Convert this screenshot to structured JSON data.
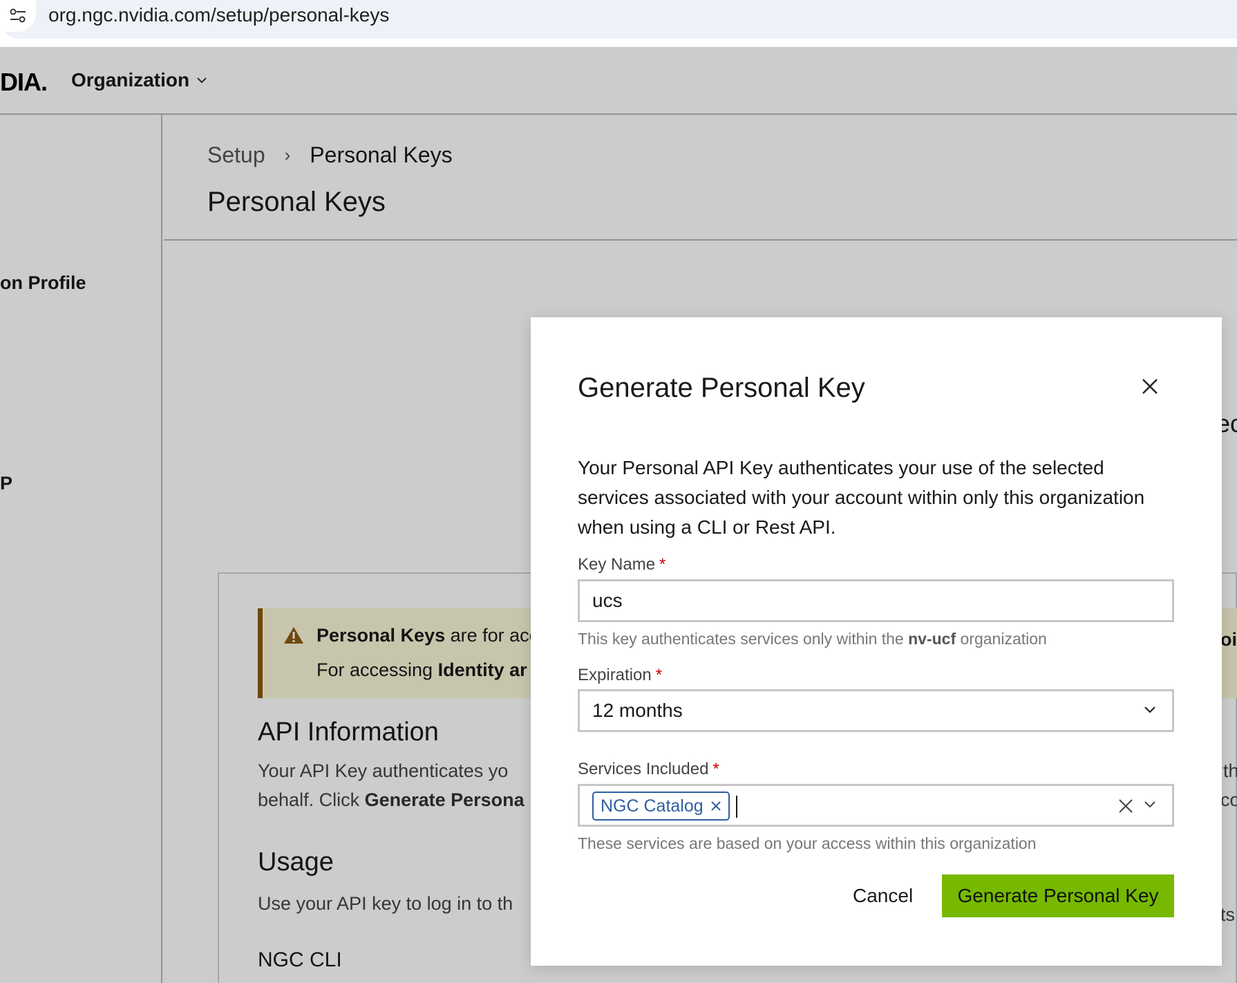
{
  "browser": {
    "url": "org.ngc.nvidia.com/setup/personal-keys"
  },
  "topnav": {
    "logo_text": "DIA.",
    "org_label": "Organization"
  },
  "sidebar": {
    "items": [
      {
        "label": "on Profile"
      },
      {
        "label": "P"
      }
    ]
  },
  "header": {
    "breadcrumb": [
      "Setup",
      "Personal Keys"
    ],
    "title": "Personal Keys"
  },
  "background_card": {
    "warning_bold_1": "Personal Keys",
    "warning_text_1": " are for acc",
    "warning_text_2a": "For accessing ",
    "warning_bold_2": "Identity ar",
    "api_heading": "API Information",
    "api_text_1": "Your API Key authenticates yo",
    "api_text_2a": "behalf. Click ",
    "api_bold_2": "Generate Persona",
    "usage_heading": "Usage",
    "usage_text": "Use your API key to log in to th",
    "ngc_cli_heading": "NGC CLI",
    "right_edge_fragments": [
      "ec",
      "oi",
      "th",
      "co",
      "ts"
    ]
  },
  "modal": {
    "title": "Generate Personal Key",
    "description": "Your Personal API Key authenticates your use of the selected services associated with your account within only this organization when using a CLI or Rest API.",
    "key_name": {
      "label": "Key Name",
      "required_mark": "*",
      "value": "ucs",
      "helper_prefix": "This key authenticates services only within the ",
      "helper_org": "nv-ucf",
      "helper_suffix": " organization"
    },
    "expiration": {
      "label": "Expiration",
      "required_mark": "*",
      "value": "12 months"
    },
    "services": {
      "label": "Services Included",
      "required_mark": "*",
      "selected": [
        "NGC Catalog"
      ],
      "helper": "These services are based on your access within this organization"
    },
    "cancel_label": "Cancel",
    "submit_label": "Generate Personal Key"
  },
  "colors": {
    "primary_button": "#76b900",
    "tag_blue": "#2f5fa0",
    "required_red": "#d00000",
    "warning_border": "#8a5a10"
  }
}
